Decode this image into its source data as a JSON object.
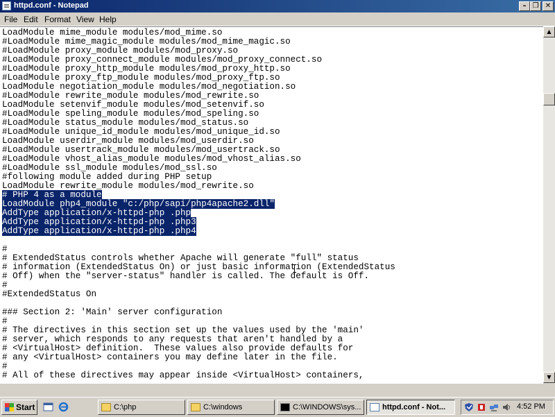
{
  "window": {
    "title": "httpd.conf - Notepad"
  },
  "menu": [
    "File",
    "Edit",
    "Format",
    "View",
    "Help"
  ],
  "editor": {
    "lines": [
      "LoadModule mime_module modules/mod_mime.so",
      "#LoadModule mime_magic_module modules/mod_mime_magic.so",
      "#LoadModule proxy_module modules/mod_proxy.so",
      "#LoadModule proxy_connect_module modules/mod_proxy_connect.so",
      "#LoadModule proxy_http_module modules/mod_proxy_http.so",
      "#LoadModule proxy_ftp_module modules/mod_proxy_ftp.so",
      "LoadModule negotiation_module modules/mod_negotiation.so",
      "#LoadModule rewrite_module modules/mod_rewrite.so",
      "LoadModule setenvif_module modules/mod_setenvif.so",
      "#LoadModule speling_module modules/mod_speling.so",
      "#LoadModule status_module modules/mod_status.so",
      "#LoadModule unique_id_module modules/mod_unique_id.so",
      "LoadModule userdir_module modules/mod_userdir.so",
      "#LoadModule usertrack_module modules/mod_usertrack.so",
      "#LoadModule vhost_alias_module modules/mod_vhost_alias.so",
      "#LoadModule ssl_module modules/mod_ssl.so",
      "#following module added during PHP setup",
      "LoadModule rewrite_module modules/mod_rewrite.so",
      "# PHP 4 as a module",
      "LoadModule php4_module \"c:/php/sapi/php4apache2.dll\"",
      "AddType application/x-httpd-php .php",
      "AddType application/x-httpd-php .php3",
      "AddType application/x-httpd-php .php4",
      "",
      "#",
      "# ExtendedStatus controls whether Apache will generate \"full\" status",
      "# information (ExtendedStatus On) or just basic information (ExtendedStatus",
      "# Off) when the \"server-status\" handler is called. The default is Off.",
      "#",
      "#ExtendedStatus On",
      "",
      "### Section 2: 'Main' server configuration",
      "#",
      "# The directives in this section set up the values used by the 'main'",
      "# server, which responds to any requests that aren't handled by a",
      "# <VirtualHost> definition.  These values also provide defaults for",
      "# any <VirtualHost> containers you may define later in the file.",
      "#",
      "# All of these directives may appear inside <VirtualHost> containers,"
    ],
    "selected_lines": [
      18,
      19,
      20,
      21,
      22
    ]
  },
  "taskbar": {
    "start_label": "Start",
    "tasks": [
      {
        "label": "C:\\php",
        "icon": "folder-icon"
      },
      {
        "label": "C:\\windows",
        "icon": "folder-icon"
      },
      {
        "label": "C:\\WINDOWS\\sys...",
        "icon": "command-prompt-icon"
      },
      {
        "label": "httpd.conf - Not...",
        "icon": "notepad-icon",
        "active": true
      }
    ],
    "clock": "4:52 PM"
  }
}
